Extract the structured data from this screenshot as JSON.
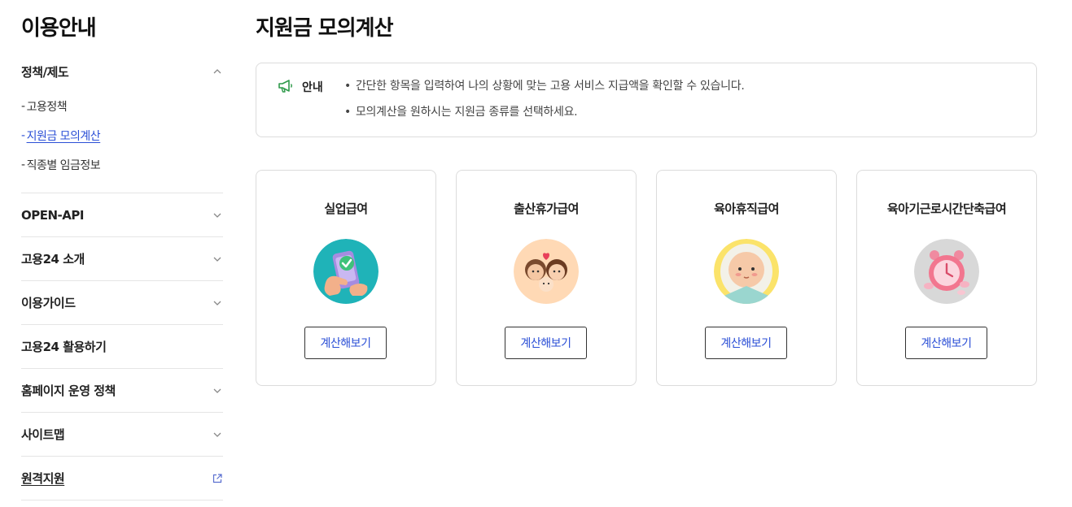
{
  "sidebar": {
    "title": "이용안내",
    "groups": [
      {
        "label": "정책/제도",
        "expanded": true,
        "items": [
          {
            "label": "고용정책"
          },
          {
            "label": "지원금 모의계산",
            "active": true
          },
          {
            "label": "직종별 임금정보"
          }
        ]
      },
      {
        "label": "OPEN-API"
      },
      {
        "label": "고용24 소개"
      },
      {
        "label": "이용가이드"
      },
      {
        "label": "고용24 활용하기"
      },
      {
        "label": "홈페이지 운영 정책"
      },
      {
        "label": "사이트맵"
      },
      {
        "label": "원격지원",
        "external": true
      }
    ],
    "dash": "-"
  },
  "main": {
    "title": "지원금 모의계산",
    "notice": {
      "label": "안내",
      "bullet": "•",
      "lines": [
        "간단한 항목을 입력하여 나의 상황에 맞는 고용 서비스 지급액을 확인할 수 있습니다.",
        "모의계산을 원하시는 지원금 종류를 선택하세요."
      ]
    },
    "cards": [
      {
        "title": "실업급여",
        "button": "계산해보기",
        "icon": "phone-check-illustration"
      },
      {
        "title": "출산휴가급여",
        "button": "계산해보기",
        "icon": "parents-baby-illustration"
      },
      {
        "title": "육아휴직급여",
        "button": "계산해보기",
        "icon": "baby-face-illustration"
      },
      {
        "title": "육아기근로시간단축급여",
        "button": "계산해보기",
        "icon": "alarm-clock-illustration"
      }
    ]
  },
  "colors": {
    "link_active": "#2b4fd6",
    "button_text": "#2b4fd6",
    "notice_icon": "#2e9a4a",
    "border": "#dcdcdc"
  }
}
